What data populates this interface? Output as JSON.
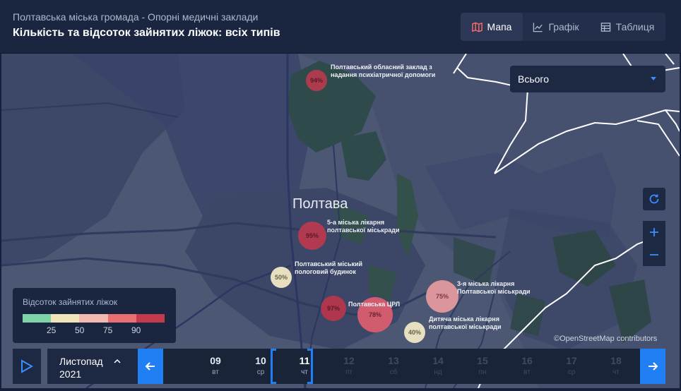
{
  "header": {
    "subtitle": "Полтавська міська громада - Опорні медичні заклади",
    "title": "Кількість та відсоток зайнятих ліжок: всіх типів",
    "tabs": [
      {
        "label": "Мапа",
        "icon": "map-icon",
        "active": true
      },
      {
        "label": "Графік",
        "icon": "line-chart-icon",
        "active": false
      },
      {
        "label": "Таблиця",
        "icon": "table-icon",
        "active": false
      }
    ]
  },
  "filter": {
    "selected": "Всього"
  },
  "map": {
    "city": "Полтава",
    "attribution": "©OpenStreetMap contributors",
    "hospitals": [
      {
        "name_line1": "Полтавський обласний заклад з",
        "name_line2": "надання психіатричної допомоги",
        "percent": "94%",
        "percent_value": 94,
        "color": "#b83a4e"
      },
      {
        "name_line1": "5-а міська лікарня",
        "name_line2": "полтавської міськради",
        "percent": "95%",
        "percent_value": 95,
        "color": "#bc3a4f"
      },
      {
        "name_line1": "Полтавський міський",
        "name_line2": "пологовий будинок",
        "percent": "50%",
        "percent_value": 50,
        "color": "#e6dfc0"
      },
      {
        "name_line1": "Полтавська ЦРЛ",
        "name_line2": "",
        "percent": "97%",
        "percent_value": 97,
        "color": "#b8354b"
      },
      {
        "name_line1": "",
        "name_line2": "",
        "percent": "78%",
        "percent_value": 78,
        "color": "#d85e6f"
      },
      {
        "name_line1": "3-я міська лікарня",
        "name_line2": "Полтавської міськради",
        "percent": "75%",
        "percent_value": 75,
        "color": "#e39a9e"
      },
      {
        "name_line1": "Дитяча міська лікарня",
        "name_line2": "полтавської міськради",
        "percent": "40%",
        "percent_value": 40,
        "color": "#e6dfc0"
      }
    ]
  },
  "legend": {
    "title": "Відсоток зайнятих ліжок",
    "colors": [
      "#7fd3a8",
      "#eee5b8",
      "#f0b8b0",
      "#ea6f72",
      "#c23a4c"
    ],
    "ticks": [
      "25",
      "50",
      "75",
      "90"
    ]
  },
  "timeline": {
    "month": "Листопад",
    "year": "2021",
    "days": [
      {
        "num": "09",
        "wd": "вт",
        "state": "past"
      },
      {
        "num": "10",
        "wd": "ср",
        "state": "past"
      },
      {
        "num": "11",
        "wd": "чт",
        "state": "current"
      },
      {
        "num": "12",
        "wd": "пт",
        "state": "future"
      },
      {
        "num": "13",
        "wd": "сб",
        "state": "future"
      },
      {
        "num": "14",
        "wd": "нд",
        "state": "future"
      },
      {
        "num": "15",
        "wd": "пн",
        "state": "future"
      },
      {
        "num": "16",
        "wd": "вт",
        "state": "future"
      },
      {
        "num": "17",
        "wd": "ср",
        "state": "future"
      },
      {
        "num": "18",
        "wd": "чт",
        "state": "future"
      }
    ]
  }
}
